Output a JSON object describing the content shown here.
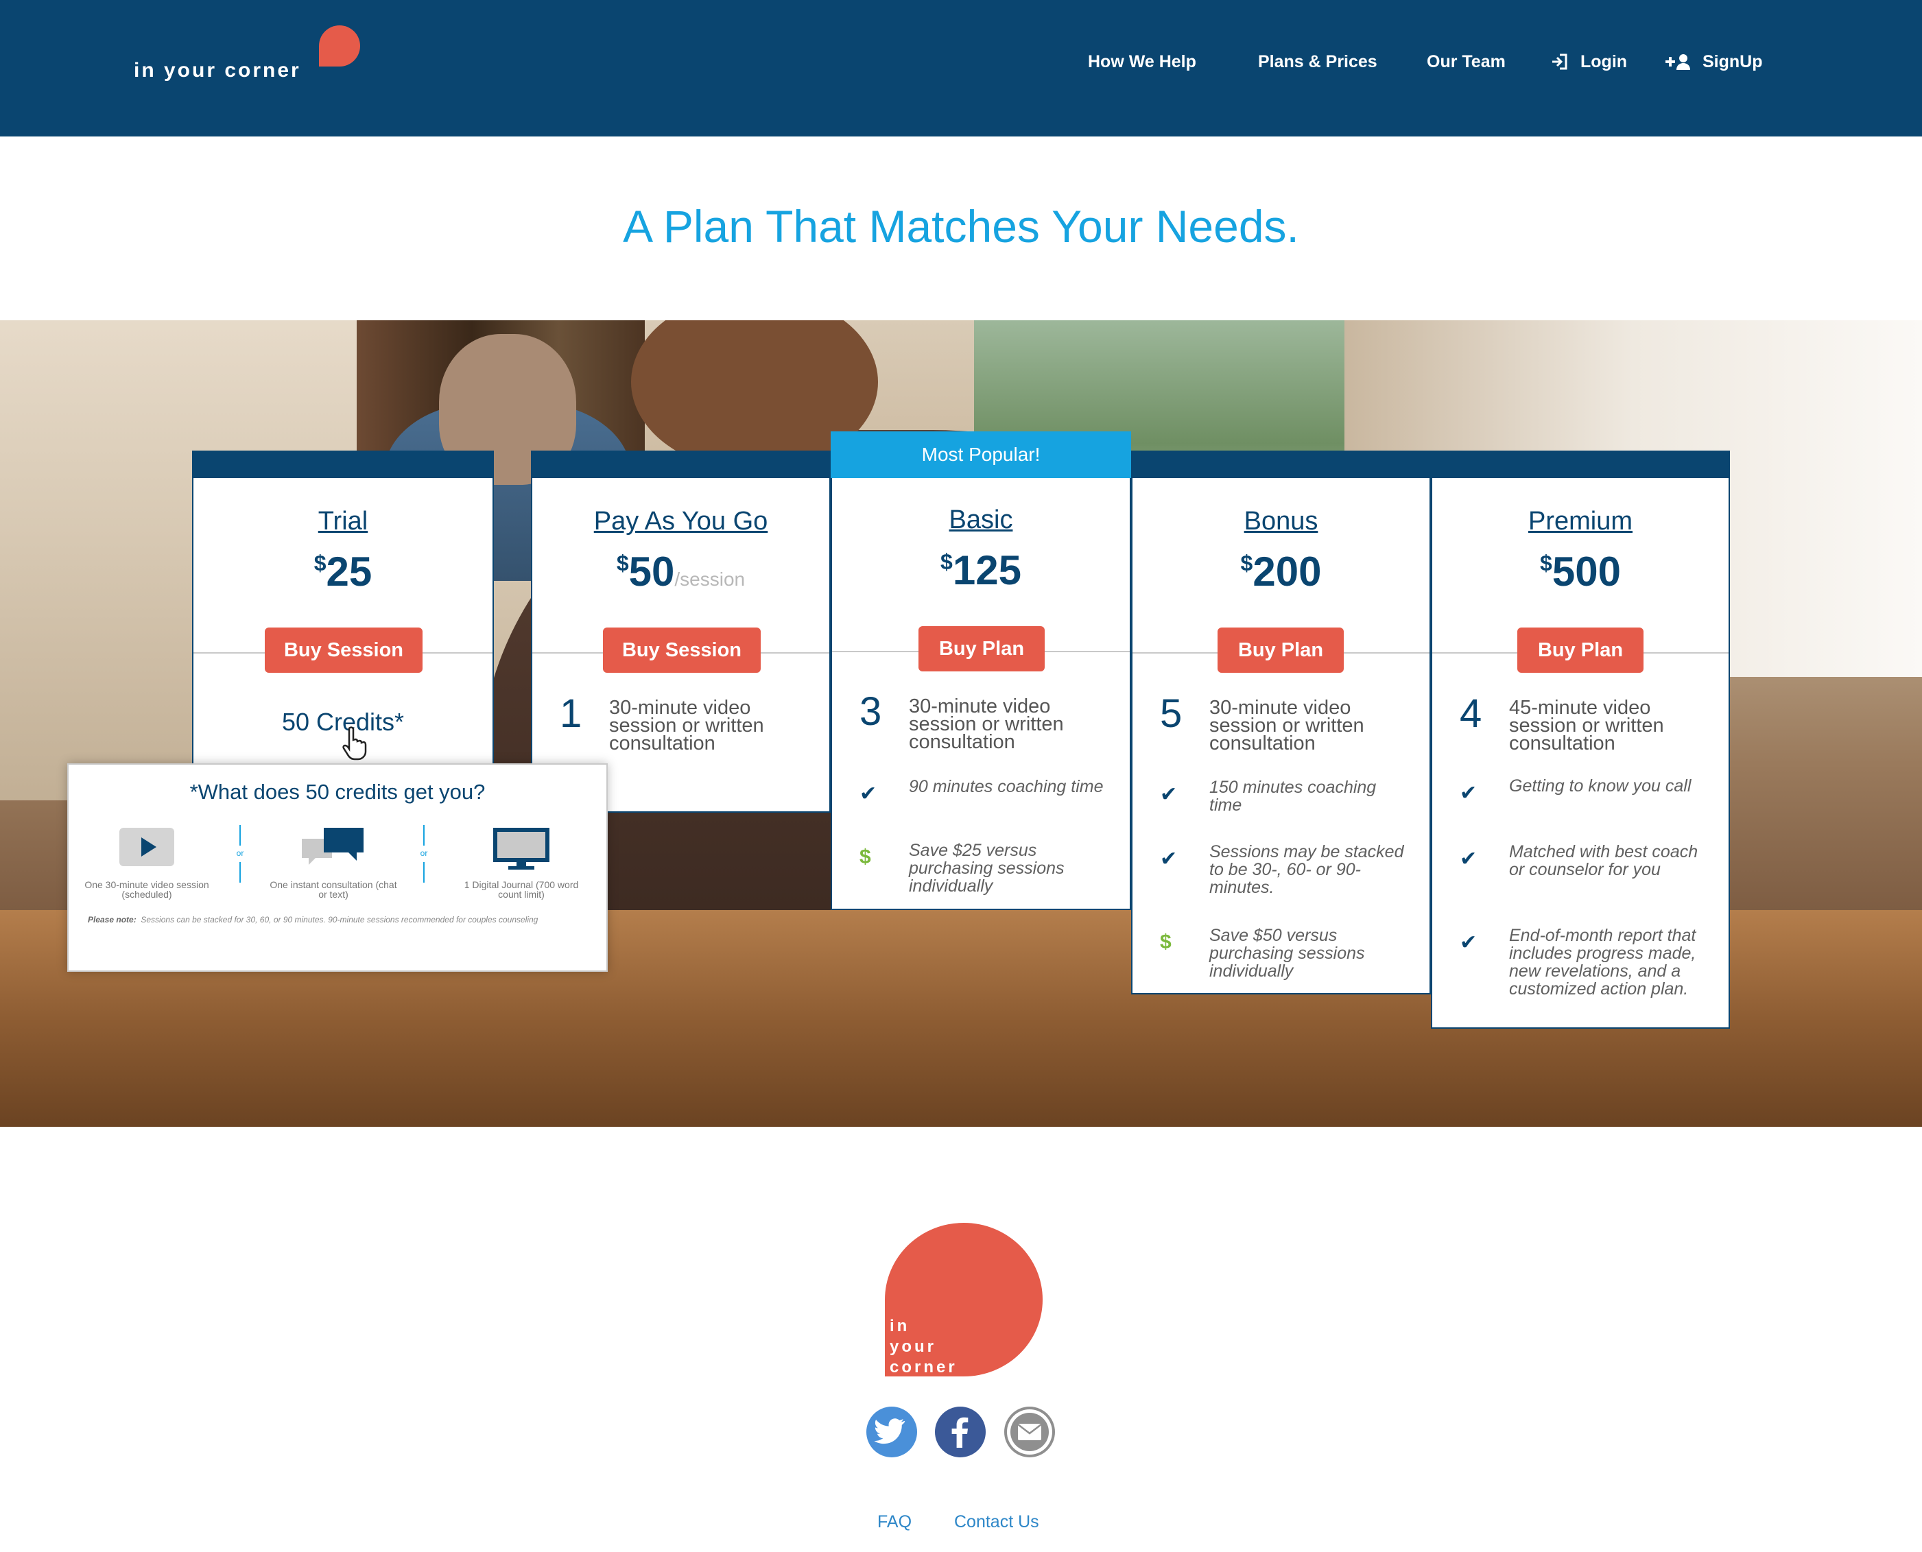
{
  "brand": {
    "logo_text": "in your corner"
  },
  "nav": [
    {
      "label": "How We Help"
    },
    {
      "label": "Plans & Prices"
    },
    {
      "label": "Our Team"
    },
    {
      "label": "Login",
      "icon": "login-icon"
    },
    {
      "label": "SignUp",
      "icon": "add-user-icon"
    }
  ],
  "headline": "A Plan That Matches Your Needs.",
  "plans": [
    {
      "name": "Trial",
      "currency": "$",
      "price": "25",
      "unit": "",
      "button": "Buy Session",
      "credits_label": "50 Credits*"
    },
    {
      "name": "Pay As You Go",
      "currency": "$",
      "price": "50",
      "unit": "/session",
      "button": "Buy Session",
      "count": "1",
      "count_desc": "30-minute video session or written consultation"
    },
    {
      "name": "Basic",
      "badge": "Most Popular!",
      "currency": "$",
      "price": "125",
      "unit": "",
      "button": "Buy Plan",
      "count": "3",
      "count_desc": "30-minute video session or written consultation",
      "features": [
        {
          "icon": "check-icon",
          "text": "90 minutes coaching time"
        },
        {
          "icon": "dollar-icon",
          "text": "Save $25 versus purchasing sessions individually"
        }
      ]
    },
    {
      "name": "Bonus",
      "currency": "$",
      "price": "200",
      "unit": "",
      "button": "Buy Plan",
      "count": "5",
      "count_desc": "30-minute video session or written consultation",
      "features": [
        {
          "icon": "check-icon",
          "text": "150 minutes coaching time"
        },
        {
          "icon": "check-icon",
          "text": "Sessions may be stacked to be 30-, 60- or 90-minutes."
        },
        {
          "icon": "dollar-icon",
          "text": "Save $50 versus purchasing sessions individually"
        }
      ]
    },
    {
      "name": "Premium",
      "currency": "$",
      "price": "500",
      "unit": "",
      "button": "Buy Plan",
      "count": "4",
      "count_desc": "45-minute video session or written consultation",
      "features": [
        {
          "icon": "check-icon",
          "text": "Getting to know you call"
        },
        {
          "icon": "check-icon",
          "text": "Matched with best coach or counselor for you"
        },
        {
          "icon": "check-icon",
          "text": "End-of-month report that includes progress made, new revelations, and a customized action plan."
        }
      ]
    }
  ],
  "popup": {
    "title": "*What does 50 credits get you?",
    "options": [
      {
        "icon": "video-play-icon",
        "caption": "One 30-minute video session (scheduled)"
      },
      {
        "icon": "chat-bubbles-icon",
        "caption": "One instant consultation (chat or text)"
      },
      {
        "icon": "monitor-icon",
        "caption": "1 Digital Journal (700 word count limit)"
      }
    ],
    "separator": "or",
    "note_label": "Please note:",
    "note_text": "Sessions can be stacked for 30, 60, or 90 minutes. 90-minute sessions recommended for couples counseling"
  },
  "footer": {
    "logo_lines": [
      "in",
      "your",
      "corner"
    ],
    "social": [
      {
        "icon": "twitter-icon",
        "color": "#4a90d9"
      },
      {
        "icon": "facebook-icon",
        "color": "#3b5998"
      },
      {
        "icon": "email-icon",
        "color": "#8f8f8f"
      }
    ],
    "links": [
      {
        "label": "FAQ"
      },
      {
        "label": "Contact Us"
      }
    ]
  },
  "colors": {
    "navy": "#0a4570",
    "accent_blue": "#16a3e0",
    "coral": "#e55b4a",
    "green": "#7bb93c"
  }
}
